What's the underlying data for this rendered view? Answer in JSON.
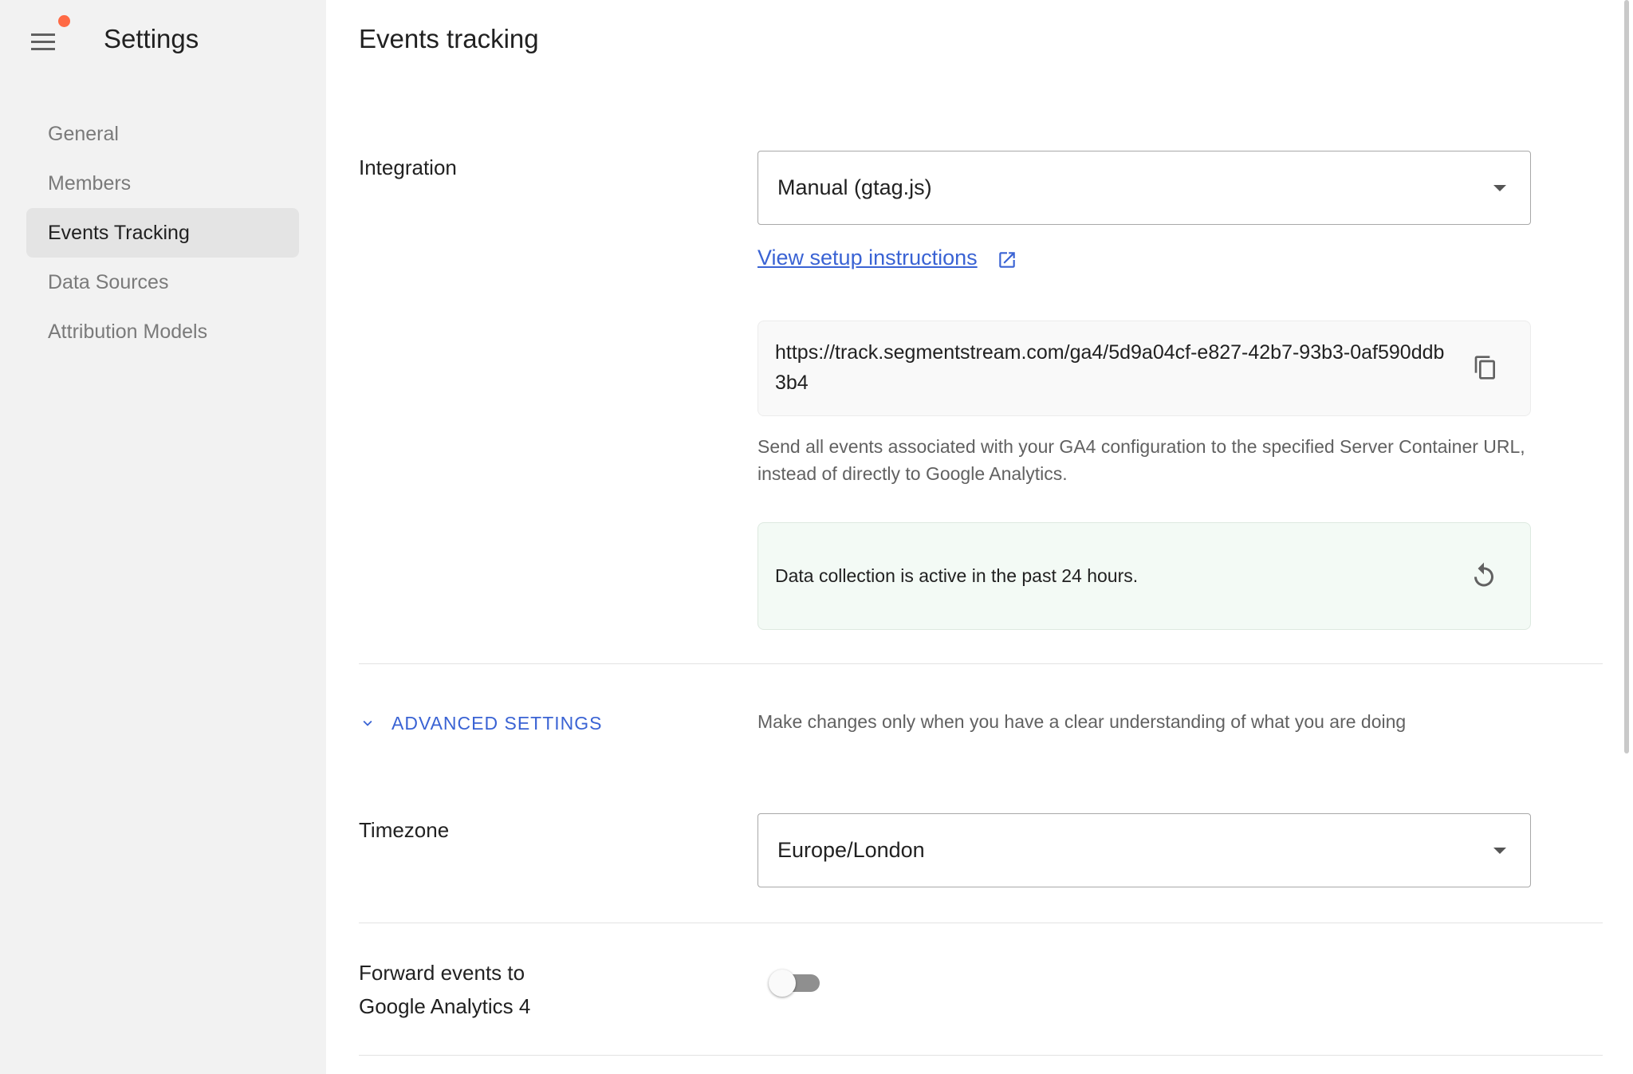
{
  "sidebar": {
    "title": "Settings",
    "items": [
      {
        "label": "General",
        "active": false
      },
      {
        "label": "Members",
        "active": false
      },
      {
        "label": "Events Tracking",
        "active": true
      },
      {
        "label": "Data Sources",
        "active": false
      },
      {
        "label": "Attribution Models",
        "active": false
      }
    ]
  },
  "main": {
    "title": "Events tracking",
    "integration": {
      "label": "Integration",
      "selected": "Manual (gtag.js)",
      "setup_link": "View setup instructions",
      "server_url": "https://track.segmentstream.com/ga4/5d9a04cf-e827-42b7-93b3-0af590ddb3b4",
      "helper": "Send all events associated with your GA4 configuration to the specified Server Container URL, instead of directly to Google Analytics.",
      "status": "Data collection is active in the past 24 hours."
    },
    "advanced": {
      "label": "ADVANCED SETTINGS",
      "description": "Make changes only when you have a clear understanding of what you are doing"
    },
    "timezone": {
      "label": "Timezone",
      "selected": "Europe/London"
    },
    "forward": {
      "label_line1": "Forward events to",
      "label_line2": "Google Analytics 4",
      "enabled": false
    }
  },
  "colors": {
    "accent": "#3a63d4",
    "notification_dot": "#ff6a45",
    "status_bg": "#f3faf5",
    "sidebar_bg": "#f2f2f2"
  },
  "icons": [
    "menu-icon",
    "notification-dot",
    "dropdown-caret-icon",
    "external-link-icon",
    "copy-icon",
    "refresh-icon",
    "chevron-down-icon"
  ]
}
